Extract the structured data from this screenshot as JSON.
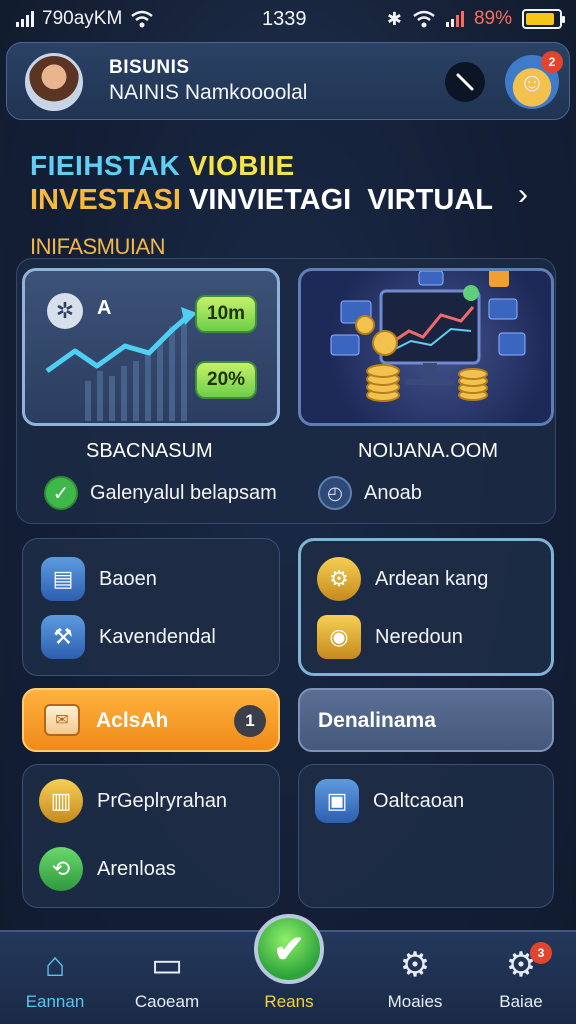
{
  "status": {
    "carrier": "790ayKM",
    "time": "1339",
    "battery_pct": "89%",
    "battery_level": 0.89
  },
  "header": {
    "title": "BISUNIS",
    "subtitle": "NAINIS Namkoooolal",
    "action_icon": "slash-icon",
    "notification_count": "2"
  },
  "hero": {
    "title_line1_a": "FIEIHSTAK",
    "title_line1_b": "VIOBIIE",
    "title_line2_a": "INVESTASI",
    "title_line2_b": "VINVIETAGI  VIRTUAL"
  },
  "section": {
    "label": "INIFASMUIAN"
  },
  "summary": {
    "chart_letter": "A",
    "pill_top": "10m",
    "pill_bottom": "20%",
    "left_caption": "SBACNASUM",
    "right_caption": "NOIJANA.OOM",
    "left_status": "Galenyalul belapsam",
    "right_status": "Anoab"
  },
  "tiles": {
    "t1_item1": "Baoen",
    "t1_item2": "Kavendendal",
    "t2_item1": "Ardean kang",
    "t2_item2": "Neredoun",
    "t3_item1": "PrGeplryrahan",
    "t3_item2": "Arenloas",
    "t4_item1": "Oaltcaoan"
  },
  "actions": {
    "orange_label": "AclsAh",
    "orange_info": "1",
    "slate_label": "Denalinama"
  },
  "nav": {
    "items": [
      {
        "label": "Eannan",
        "icon": "home-icon"
      },
      {
        "label": "Caoeam",
        "icon": "monitor-icon"
      },
      {
        "label": "Reans",
        "icon": "check-icon"
      },
      {
        "label": "Moaies",
        "icon": "gear-icon"
      },
      {
        "label": "Baiae",
        "icon": "gear-icon"
      }
    ],
    "last_badge": "3"
  },
  "colors": {
    "accent_blue": "#56c5f2",
    "accent_yellow": "#f6e24a",
    "accent_orange": "#f08a1a",
    "accent_green": "#3fb84a",
    "background": "#17233a"
  }
}
